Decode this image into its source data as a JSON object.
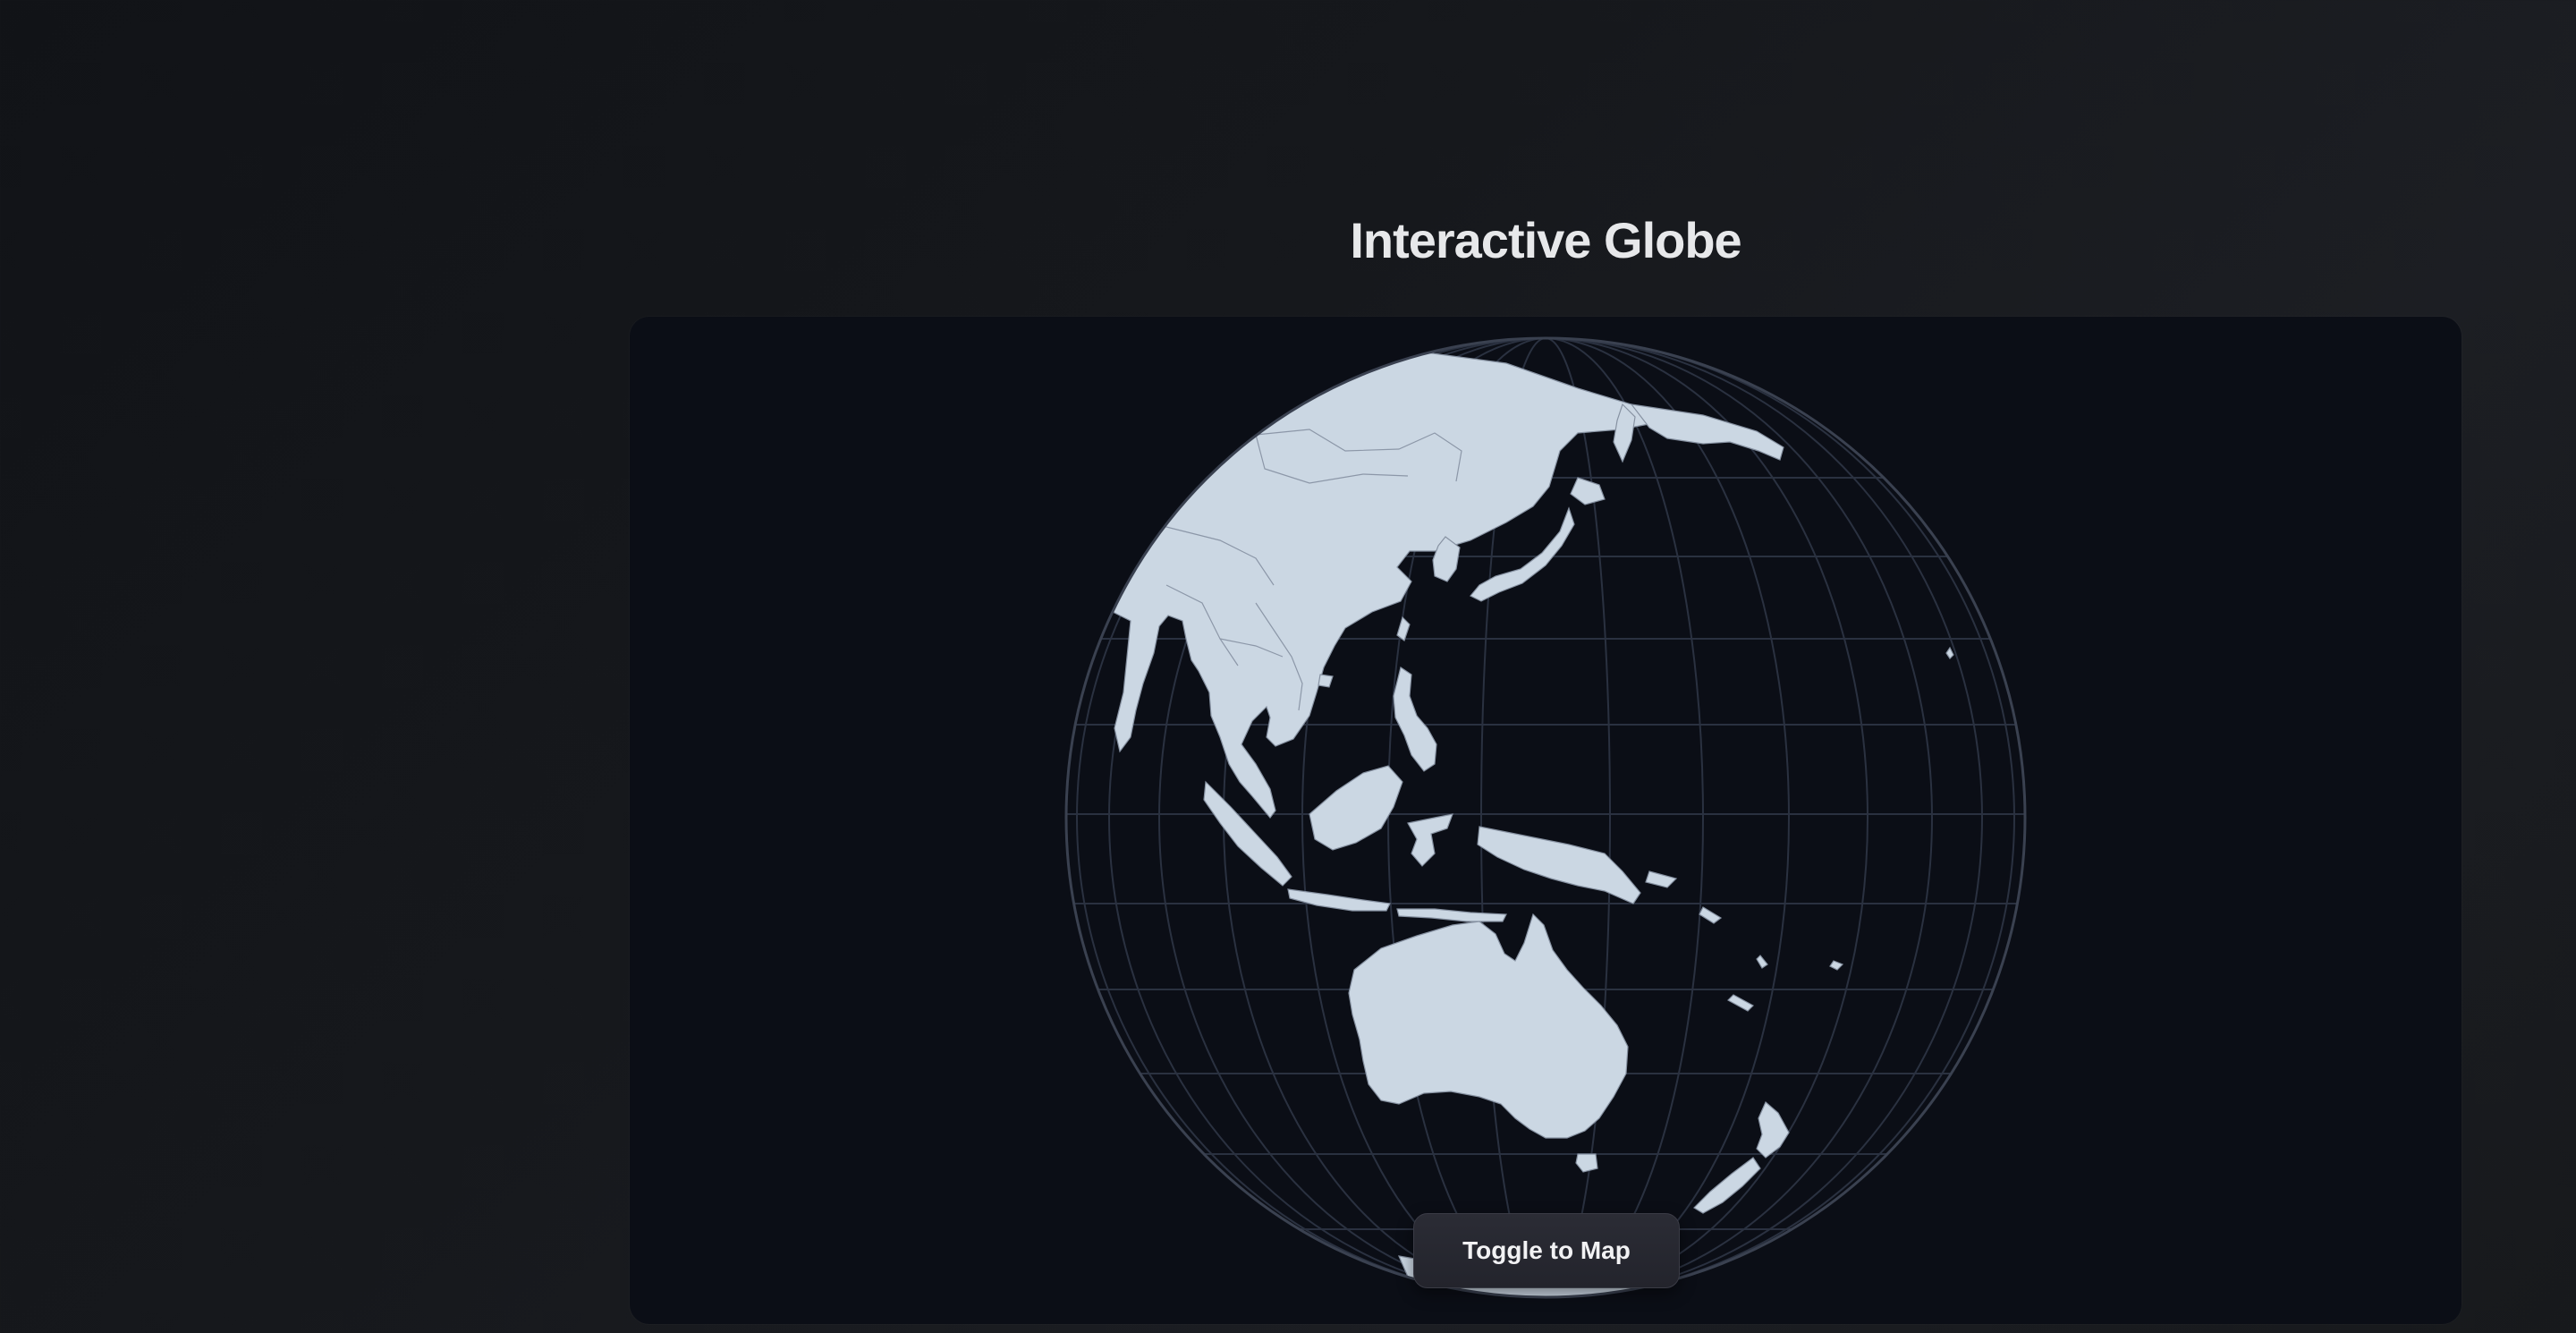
{
  "header": {
    "title": "Interactive Globe"
  },
  "globe": {
    "view_center": "Asia-Pacific",
    "land_color": "#cbd7e3",
    "ocean_color": "#0b0e16",
    "graticule_color": "#2a3140",
    "outline_color": "#3a4150"
  },
  "controls": {
    "toggle_label": "Toggle to Map"
  }
}
